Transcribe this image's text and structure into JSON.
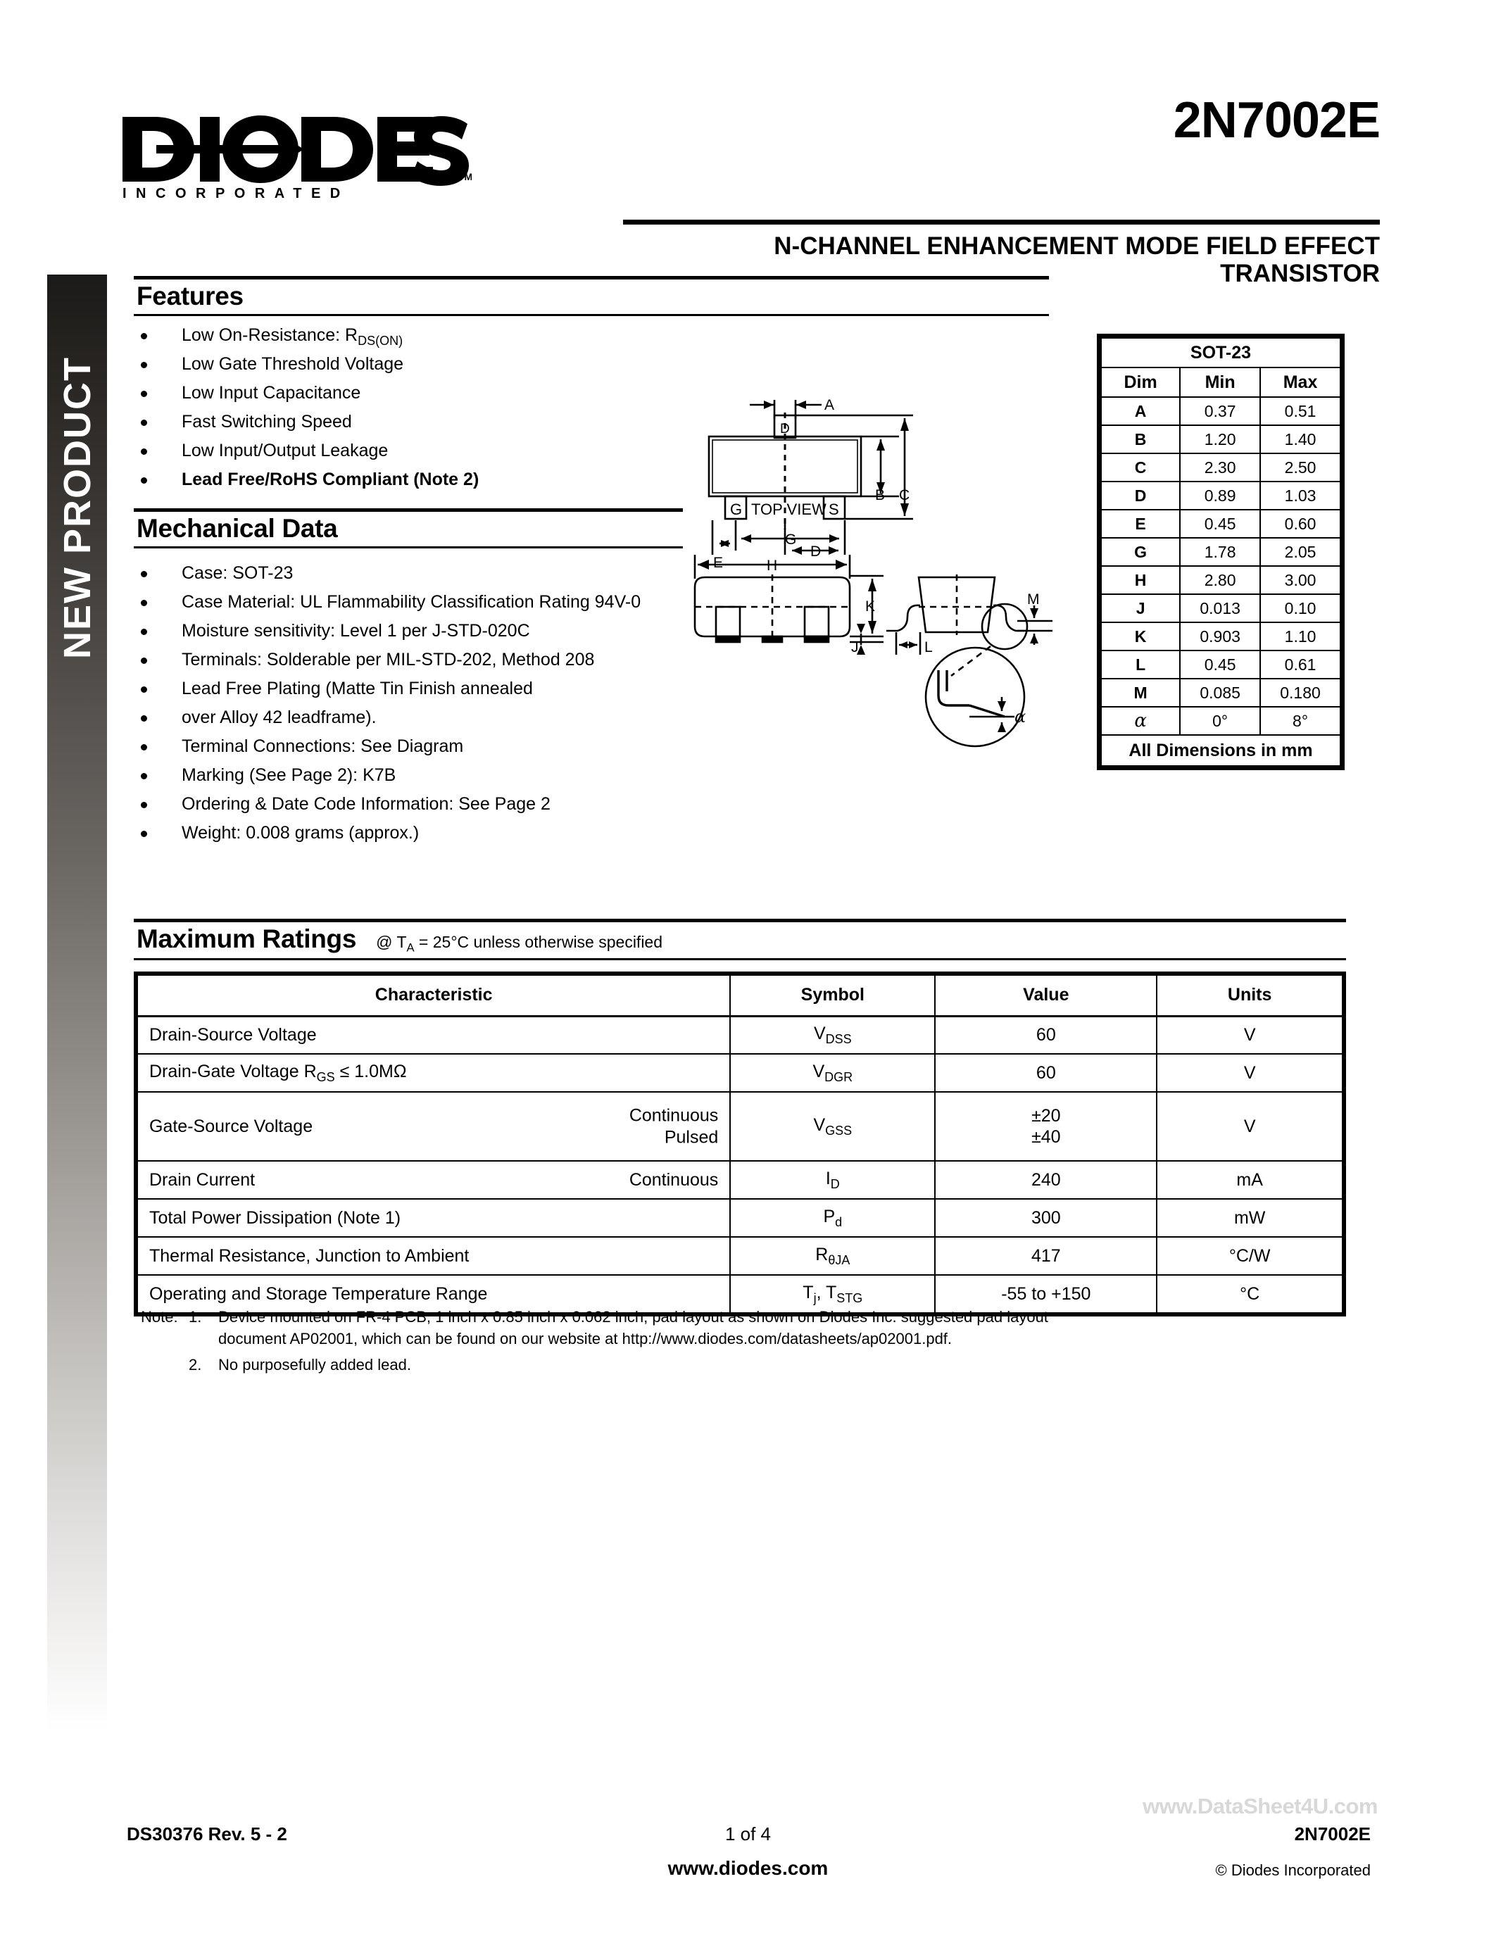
{
  "sidebar": {
    "label": "NEW PRODUCT"
  },
  "header": {
    "logo_text": "DIODES",
    "logo_sub": "INCORPORATED",
    "logo_tm": "TM",
    "part_number": "2N7002E",
    "subtitle_line1": "N-CHANNEL ENHANCEMENT MODE FIELD EFFECT",
    "subtitle_line2": "TRANSISTOR"
  },
  "features": {
    "title": "Features",
    "items": [
      {
        "text": "Low On-Resistance: R",
        "sub": "DS(ON)",
        "bold": false
      },
      {
        "text": "Low Gate Threshold Voltage",
        "bold": false
      },
      {
        "text": "Low Input Capacitance",
        "bold": false
      },
      {
        "text": "Fast Switching Speed",
        "bold": false
      },
      {
        "text": "Low Input/Output Leakage",
        "bold": false
      },
      {
        "text": "Lead Free/RoHS Compliant (Note 2)",
        "bold": true
      }
    ]
  },
  "mechanical": {
    "title": "Mechanical Data",
    "items": [
      "Case: SOT-23",
      "Case Material: UL Flammability Classification Rating 94V-0",
      "Moisture sensitivity: Level 1 per J-STD-020C",
      "Terminals: Solderable per MIL-STD-202, Method 208",
      "Lead Free Plating (Matte Tin Finish annealed",
      "over Alloy 42 leadframe).",
      "Terminal Connections: See Diagram",
      "Marking (See Page 2): K7B",
      "Ordering & Date Code Information: See Page 2",
      "Weight: 0.008 grams (approx.)"
    ]
  },
  "dim_table": {
    "title": "SOT-23",
    "headers": [
      "Dim",
      "Min",
      "Max"
    ],
    "rows": [
      [
        "A",
        "0.37",
        "0.51"
      ],
      [
        "B",
        "1.20",
        "1.40"
      ],
      [
        "C",
        "2.30",
        "2.50"
      ],
      [
        "D",
        "0.89",
        "1.03"
      ],
      [
        "E",
        "0.45",
        "0.60"
      ],
      [
        "G",
        "1.78",
        "2.05"
      ],
      [
        "H",
        "2.80",
        "3.00"
      ],
      [
        "J",
        "0.013",
        "0.10"
      ],
      [
        "K",
        "0.903",
        "1.10"
      ],
      [
        "L",
        "0.45",
        "0.61"
      ],
      [
        "M",
        "0.085",
        "0.180"
      ],
      [
        "α",
        "0°",
        "8°"
      ]
    ],
    "footer": "All Dimensions in mm"
  },
  "package_drawing": {
    "top_view_label": "TOP VIEW",
    "pin_labels": [
      "G",
      "S",
      "D"
    ],
    "dim_labels": [
      "A",
      "B",
      "C",
      "D",
      "E",
      "G",
      "H",
      "J",
      "K",
      "L",
      "M",
      "α"
    ]
  },
  "max_ratings": {
    "title": "Maximum Ratings",
    "condition": "@ T",
    "condition_sub": "A",
    "condition_rest": " = 25°C unless otherwise specified",
    "headers": [
      "Characteristic",
      "Symbol",
      "Value",
      "Units"
    ],
    "rows": [
      {
        "characteristic": "Drain-Source Voltage",
        "qualifier": "",
        "symbol": "V",
        "symbol_sub": "DSS",
        "value": "60",
        "units": "V"
      },
      {
        "characteristic": "Drain-Gate Voltage R",
        "char_sub": "GS",
        "char_rest": " ≤ 1.0MΩ",
        "qualifier": "",
        "symbol": "V",
        "symbol_sub": "DGR",
        "value": "60",
        "units": "V"
      },
      {
        "characteristic": "Gate-Source Voltage",
        "qualifier": "Continuous\nPulsed",
        "symbol": "V",
        "symbol_sub": "GSS",
        "value": "±20\n±40",
        "units": "V"
      },
      {
        "characteristic": "Drain Current",
        "qualifier": "Continuous",
        "symbol": "I",
        "symbol_sub": "D",
        "value": "240",
        "units": "mA"
      },
      {
        "characteristic": "Total Power Dissipation (Note 1)",
        "qualifier": "",
        "symbol": "P",
        "symbol_sub": "d",
        "value": "300",
        "units": "mW"
      },
      {
        "characteristic": "Thermal Resistance, Junction to Ambient",
        "qualifier": "",
        "symbol": "R",
        "symbol_sub": "θJA",
        "value": "417",
        "units": "°C/W"
      },
      {
        "characteristic": "Operating and Storage Temperature Range",
        "qualifier": "",
        "symbol": "T",
        "symbol_sub": "j",
        "symbol_rest": ", T",
        "symbol_sub2": "STG",
        "value": "-55 to +150",
        "units": "°C"
      }
    ]
  },
  "notes": {
    "label": "Note:",
    "items": [
      {
        "num": "1.",
        "line1": "Device mounted on FR-4 PCB, 1 inch x 0.85 inch x 0.062 inch; pad layout as shown on Diodes Inc. suggested pad layout",
        "line2": "document AP02001, which can be found on our website at http://www.diodes.com/datasheets/ap02001.pdf."
      },
      {
        "num": "2.",
        "line1": "No purposefully added lead.",
        "line2": ""
      }
    ]
  },
  "footer": {
    "doc_id": "DS30376 Rev. 5 - 2",
    "page": "1 of 4",
    "website": "www.diodes.com",
    "part": "2N7002E",
    "copyright": "© Diodes Incorporated",
    "watermark": "www.DataSheet4U.com"
  }
}
